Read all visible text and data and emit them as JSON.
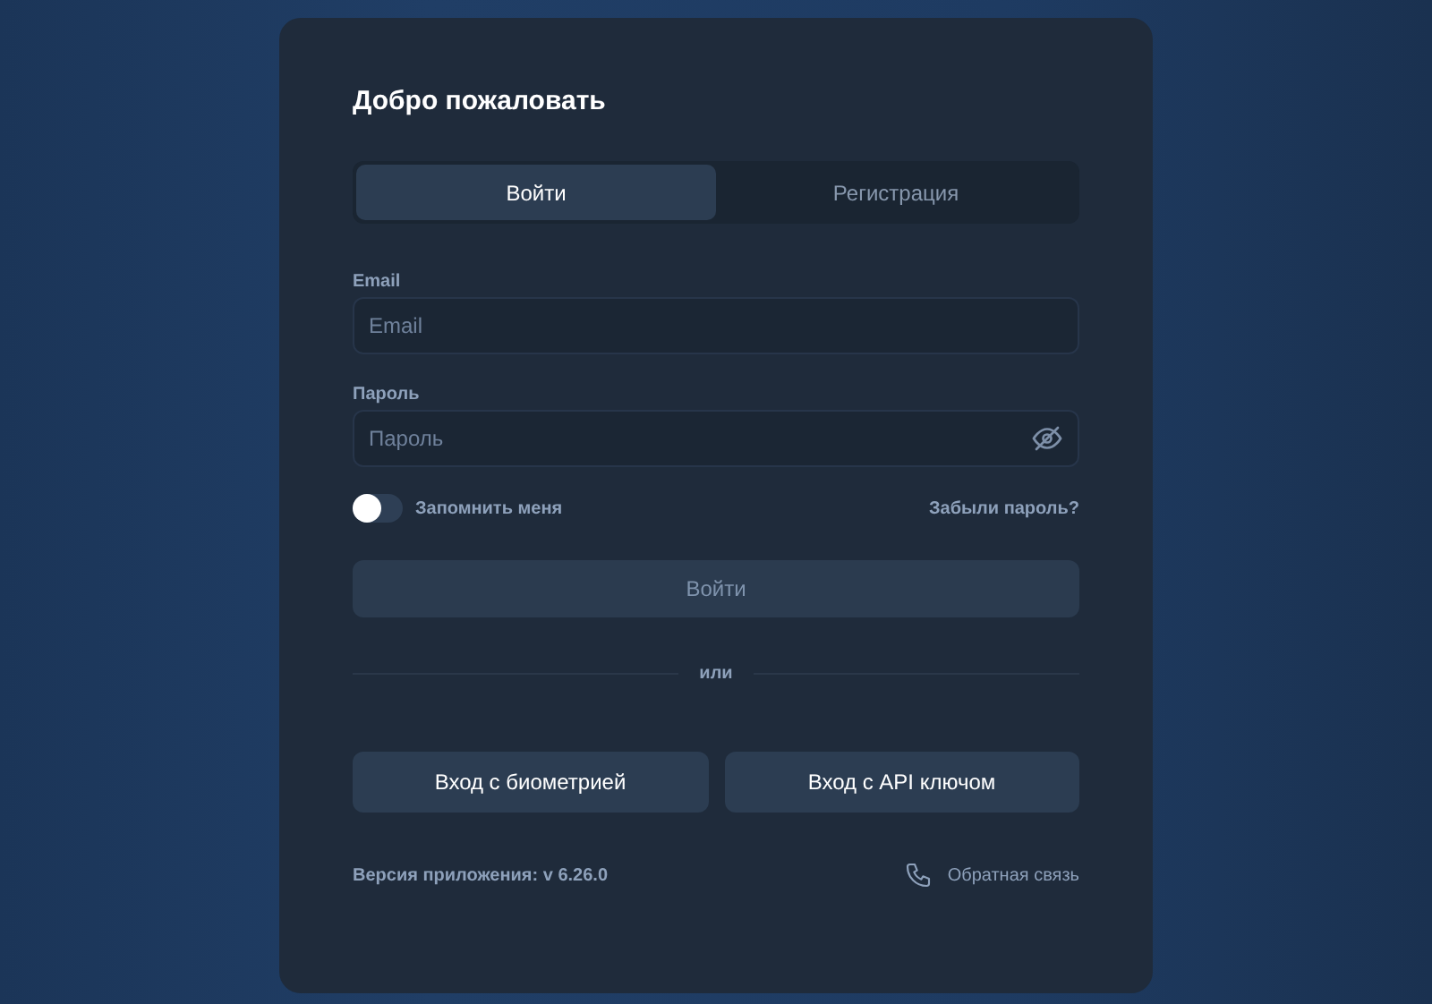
{
  "title": "Добро пожаловать",
  "tabs": [
    {
      "label": "Войти",
      "selected": true
    },
    {
      "label": "Регистрация",
      "selected": false
    }
  ],
  "fields": [
    {
      "label": "Email",
      "placeholder": "Email",
      "kind": "text"
    },
    {
      "label": "Пароль",
      "placeholder": "Пароль",
      "kind": "password"
    }
  ],
  "remember": {
    "label": "Запомнить меня",
    "on": false
  },
  "forgot_link": "Забыли пароль?",
  "submit": {
    "label": "Войти",
    "disabled": true
  },
  "divider": "или",
  "alt_buttons": [
    "Вход с биометрией",
    "Вход с API ключом"
  ],
  "version": "Версия приложения: v 6.26.0",
  "feedback_link": "Обратная связь"
}
